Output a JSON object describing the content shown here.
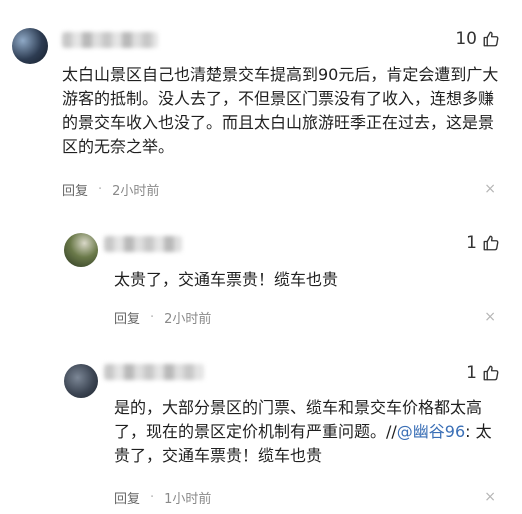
{
  "comments": [
    {
      "likes": "10",
      "text": "太白山景区自己也清楚景交车提高到90元后，肯定会遭到广大游客的抵制。没人去了，不但景区门票没有了收入，连想多赚的景交车收入也没了。而且太白山旅游旺季正在过去，这是景区的无奈之举。",
      "reply_label": "回复",
      "time": "2小时前",
      "close": "×"
    },
    {
      "likes": "1",
      "text": "太贵了，交通车票贵！缆车也贵",
      "reply_label": "回复",
      "time": "2小时前",
      "close": "×"
    },
    {
      "likes": "1",
      "text_before": "是的，大部分景区的门票、缆车和景交车价格都太高了，现在的景区定价机制有严重问题。//",
      "mention": "@幽谷96",
      "text_after": ": 太贵了，交通车票贵！缆车也贵",
      "reply_label": "回复",
      "time": "1小时前",
      "close": "×"
    }
  ],
  "separator": "·",
  "icons": [
    "thumbs-up-icon",
    "close-icon"
  ]
}
